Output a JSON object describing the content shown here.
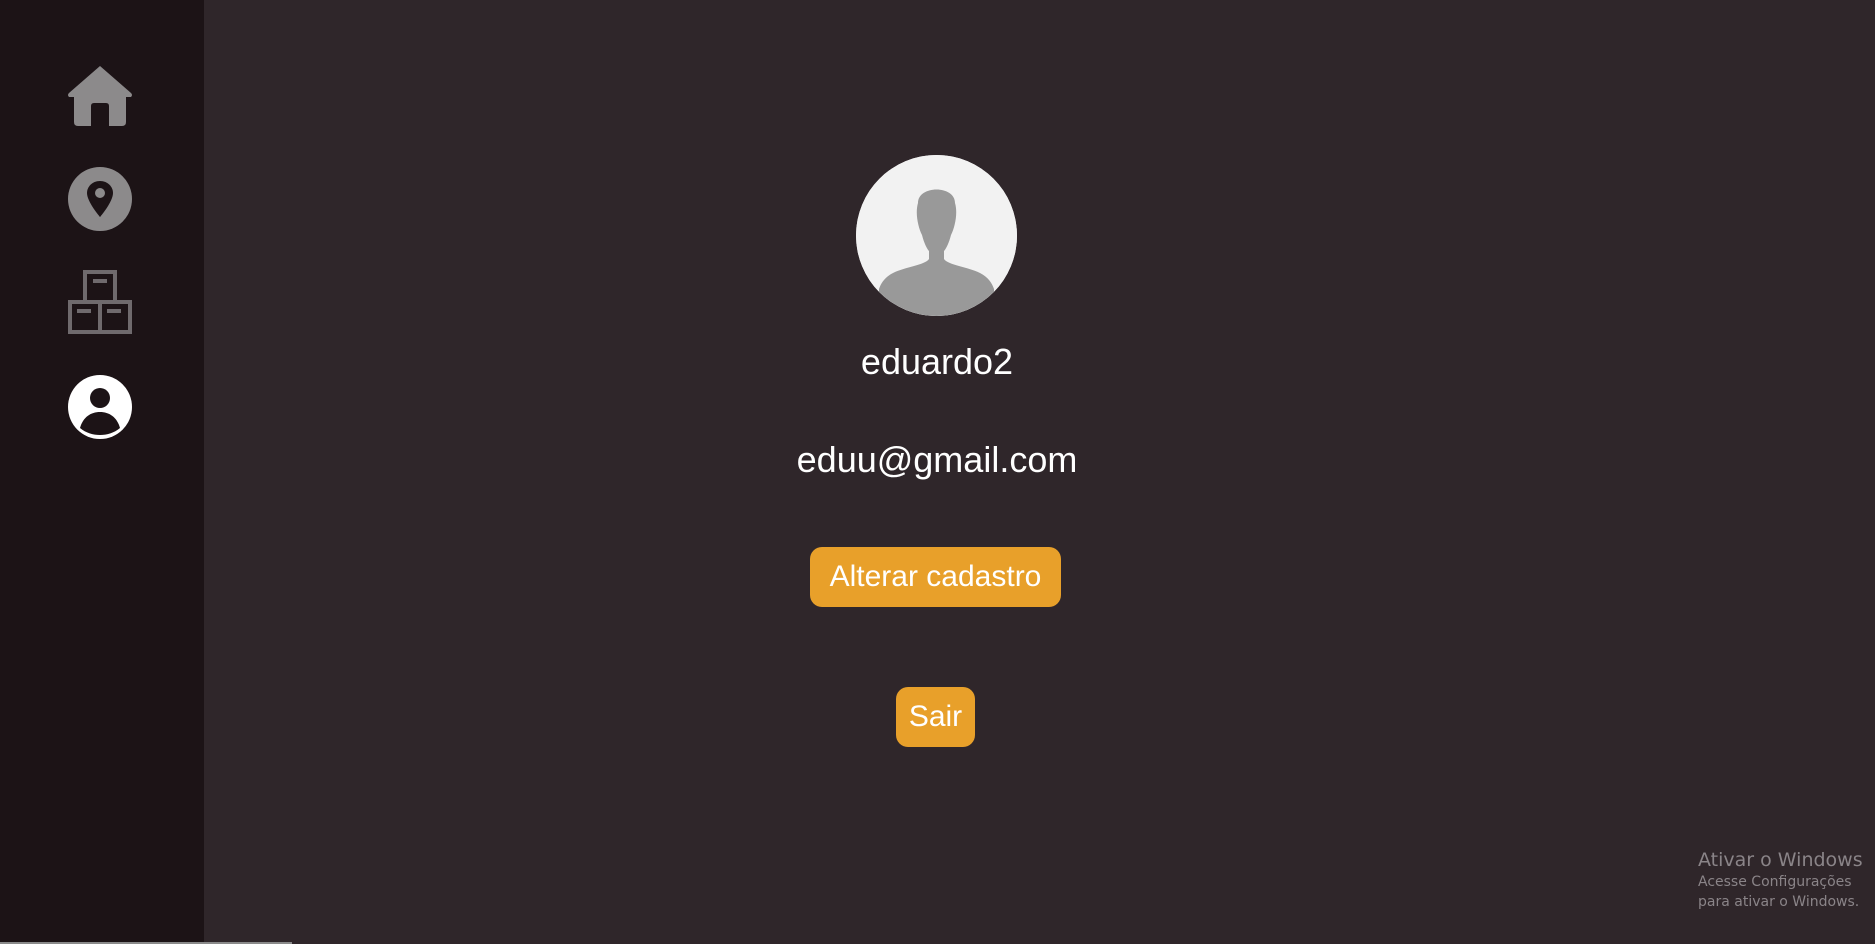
{
  "sidebar": {
    "items": [
      {
        "icon": "home-icon",
        "active": false
      },
      {
        "icon": "map-pin-icon",
        "active": false
      },
      {
        "icon": "boxes-icon",
        "active": false
      },
      {
        "icon": "user-profile-icon",
        "active": true
      }
    ]
  },
  "profile": {
    "username": "eduardo2",
    "email": "eduu@gmail.com",
    "edit_button_label": "Alterar cadastro",
    "logout_button_label": "Sair"
  },
  "watermark": {
    "title": "Ativar o Windows",
    "subtitle": "Acesse Configurações para ativar o Windows."
  },
  "colors": {
    "background": "#2f262a",
    "sidebar": "#1c1316",
    "accent": "#e8a02a",
    "icon_inactive": "#8c8a8b",
    "icon_active": "#ffffff"
  }
}
